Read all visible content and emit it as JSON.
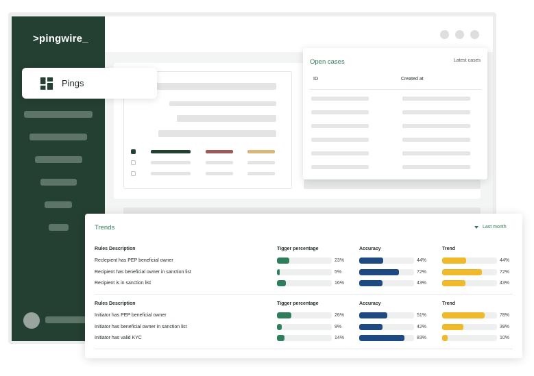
{
  "app": {
    "brand": ">pingwire_",
    "menu": {
      "label": "Pings",
      "icon": "dashboard-icon"
    }
  },
  "open_cases": {
    "title": "Open cases",
    "filter_label": "Latest cases",
    "columns": [
      "ID",
      "Created at"
    ]
  },
  "trends": {
    "title": "Trends",
    "period_label": "Last month",
    "headers": [
      "Rules Description",
      "Tigger percentage",
      "Accuracy",
      "Trend"
    ],
    "colors": {
      "trigger": "#2e7d5b",
      "accuracy": "#1e4a82",
      "trend": "#f0b92b"
    },
    "groups": [
      {
        "rows": [
          {
            "description": "Reclepient has PEP beneficial owner",
            "trigger": "23%",
            "accuracy": "44%",
            "trend": "44%"
          },
          {
            "description": "Recipient has beneficial owner in sanction list",
            "trigger": "5%",
            "accuracy": "72%",
            "trend": "72%"
          },
          {
            "description": "Recipient is in sanction list",
            "trigger": "16%",
            "accuracy": "43%",
            "trend": "43%"
          }
        ]
      },
      {
        "rows": [
          {
            "description": "Initiator has PEP beneficial owner",
            "trigger": "26%",
            "accuracy": "51%",
            "trend": "78%"
          },
          {
            "description": "Initiator has beneficial owner in sanction list",
            "trigger": "9%",
            "accuracy": "42%",
            "trend": "39%"
          },
          {
            "description": "Initiator has valid KYC",
            "trigger": "14%",
            "accuracy": "83%",
            "trend": "10%"
          }
        ]
      }
    ]
  }
}
